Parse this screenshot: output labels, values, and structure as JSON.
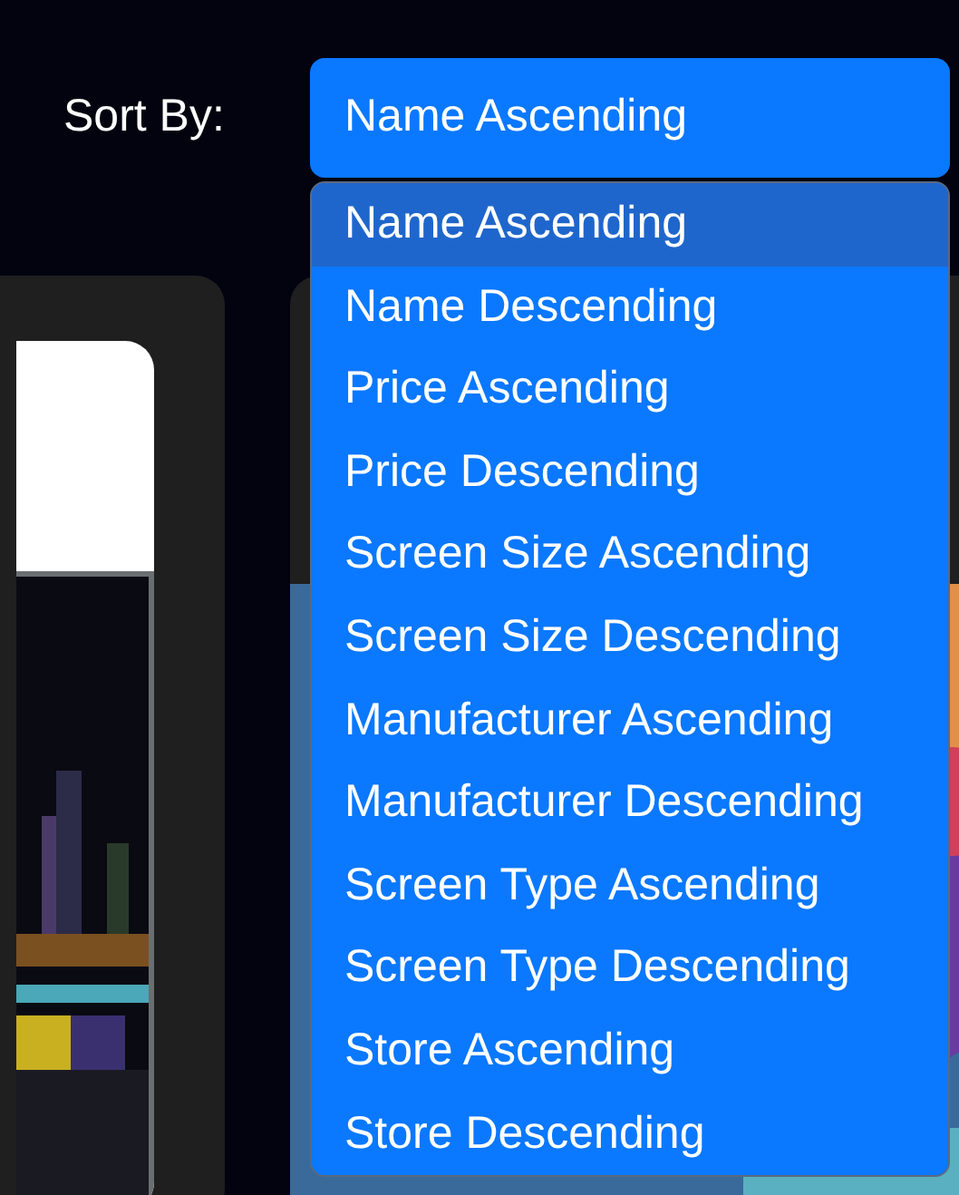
{
  "sort": {
    "label": "Sort By:",
    "value": "Name Ascending"
  },
  "options": [
    {
      "label": "Name Ascending",
      "selected": true
    },
    {
      "label": "Name Descending",
      "selected": false
    },
    {
      "label": "Price Ascending",
      "selected": false
    },
    {
      "label": "Price Descending",
      "selected": false
    },
    {
      "label": "Screen Size Ascending",
      "selected": false
    },
    {
      "label": "Screen Size Descending",
      "selected": false
    },
    {
      "label": "Manufacturer Ascending",
      "selected": false
    },
    {
      "label": "Manufacturer Descending",
      "selected": false
    },
    {
      "label": "Screen Type Ascending",
      "selected": false
    },
    {
      "label": "Screen Type Descending",
      "selected": false
    },
    {
      "label": "Store Ascending",
      "selected": false
    },
    {
      "label": "Store Descending",
      "selected": false
    }
  ]
}
